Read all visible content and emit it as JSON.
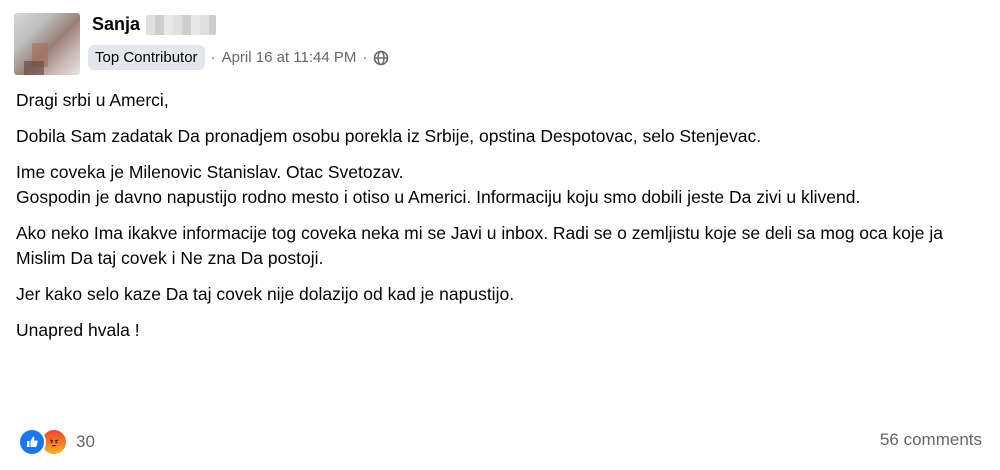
{
  "post": {
    "author": "Sanja",
    "badge": "Top Contributor",
    "separator1": "·",
    "timestamp": "April 16 at 11:44 PM",
    "separator2": "·",
    "audience_icon": "globe-icon",
    "paragraphs": [
      "Dragi srbi u Amerci,",
      "Dobila Sam zadatak Da pronadjem osobu porekla iz Srbije, opstina Despotovac, selo Stenjevac.",
      "Ime coveka je Milenovic Stanislav. Otac Svetozav.\nGospodin je davno napustijo rodno mesto i otiso u Americi. Informaciju koju smo dobili jeste Da zivi u klivend.",
      "Ako neko Ima ikakve informacije tog coveka neka mi se Javi u inbox.  Radi se o zemljistu koje se deli sa mog oca koje ja Mislim Da taj covek i Ne zna Da postoji.",
      "Jer kako selo kaze Da taj covek nije dolazijo od kad je napustijo.",
      "Unapred hvala !"
    ],
    "reactions": {
      "icons": [
        "like-icon",
        "angry-icon"
      ],
      "count": "30"
    },
    "comments": "56 comments"
  },
  "colors": {
    "text": "#050505",
    "secondary": "#65676b",
    "badge_bg": "#e4e6eb",
    "like": "#1877f2"
  }
}
